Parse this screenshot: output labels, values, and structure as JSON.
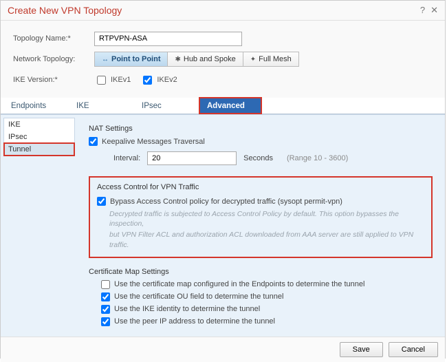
{
  "dialog": {
    "title": "Create New VPN Topology",
    "help_icon": "?",
    "close_icon": "✕"
  },
  "form": {
    "name_label": "Topology Name:*",
    "name_value": "RTPVPN-ASA",
    "net_topo_label": "Network Topology:",
    "topo_ptp": "Point to Point",
    "topo_hub": "Hub and Spoke",
    "topo_full": "Full Mesh",
    "ike_label": "IKE Version:*",
    "ikev1": "IKEv1",
    "ikev2": "IKEv2"
  },
  "tabs": {
    "endpoints": "Endpoints",
    "ike": "IKE",
    "ipsec": "IPsec",
    "advanced": "Advanced"
  },
  "tree": {
    "ike": "IKE",
    "ipsec": "IPsec",
    "tunnel": "Tunnel"
  },
  "nat": {
    "title": "NAT Settings",
    "keepalive": "Keepalive Messages Traversal",
    "interval_label": "Interval:",
    "interval_value": "20",
    "interval_unit": "Seconds",
    "interval_range": "(Range 10 - 3600)"
  },
  "access": {
    "title": "Access Control for VPN Traffic",
    "bypass": "Bypass Access Control policy for decrypted traffic (sysopt permit-vpn)",
    "desc1": "Decrypted traffic is subjected to Access Control Policy by default. This option bypasses the inspection,",
    "desc2": "but VPN Filter ACL and authorization ACL downloaded from AAA server are still applied to VPN traffic."
  },
  "cert": {
    "title": "Certificate Map Settings",
    "c1": "Use the certificate map configured in the Endpoints to determine the tunnel",
    "c2": "Use the certificate OU field to determine the tunnel",
    "c3": "Use the IKE identity to determine the tunnel",
    "c4": "Use the peer IP address to determine the tunnel"
  },
  "footer": {
    "save": "Save",
    "cancel": "Cancel"
  }
}
